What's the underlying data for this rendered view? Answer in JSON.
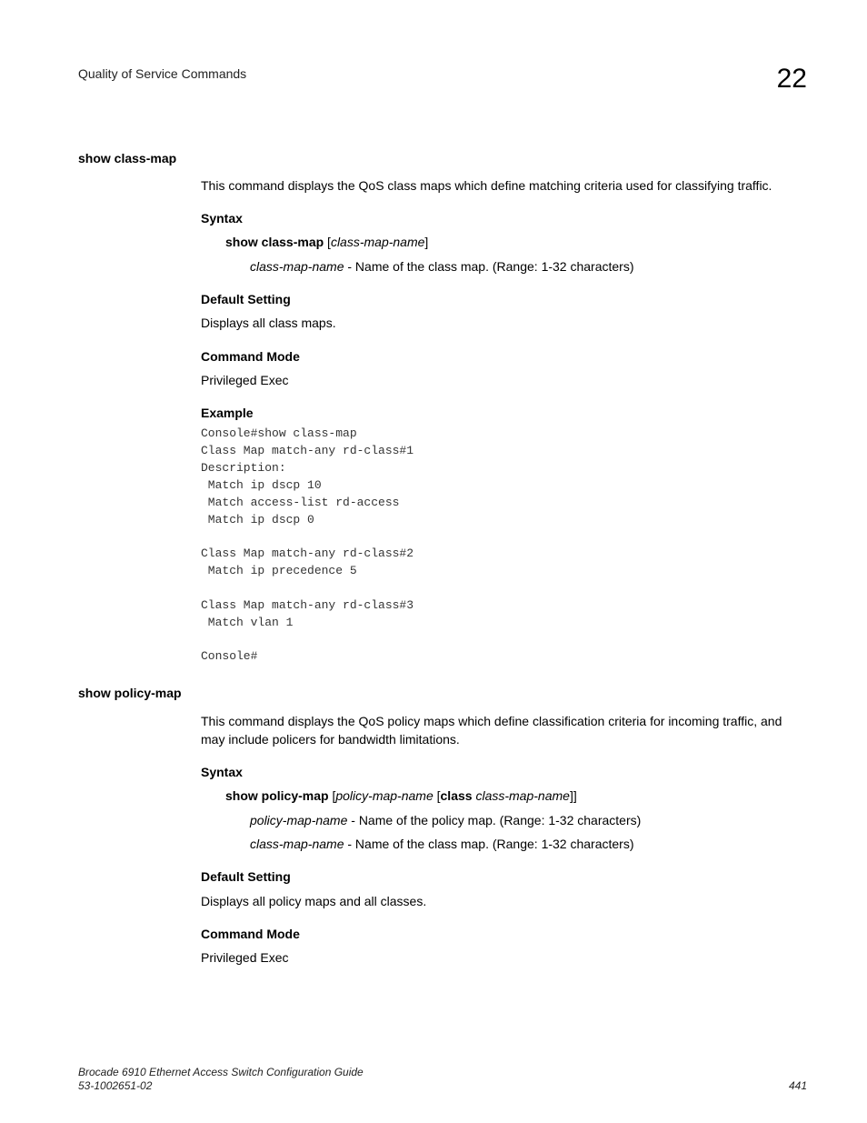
{
  "header": {
    "running_title": "Quality of Service Commands",
    "chapter_number": "22"
  },
  "sections": [
    {
      "left_heading": "show class-map",
      "intro": "This command displays the QoS class maps which define matching criteria used for classifying traffic.",
      "syntax_heading": "Syntax",
      "syntax_cmd_bold": "show class-map",
      "syntax_open_bracket": " [",
      "syntax_param_ital": "class-map-name",
      "syntax_close_bracket": "]",
      "params": [
        {
          "name": "class-map-name",
          "desc": " - Name of the class map. (Range: 1-32 characters)"
        }
      ],
      "default_heading": "Default Setting",
      "default_text": "Displays all class maps.",
      "mode_heading": "Command Mode",
      "mode_text": "Privileged Exec",
      "example_heading": "Example",
      "example_code": "Console#show class-map \nClass Map match-any rd-class#1\nDescription:\n Match ip dscp 10\n Match access-list rd-access\n Match ip dscp 0\n\nClass Map match-any rd-class#2\n Match ip precedence 5\n\nClass Map match-any rd-class#3\n Match vlan 1\n\nConsole#"
    },
    {
      "left_heading": "show policy-map",
      "intro": "This command displays the QoS policy maps which define classification criteria for incoming traffic, and may include policers for bandwidth limitations.",
      "syntax_heading": "Syntax",
      "syntax_cmd_bold1": "show policy-map",
      "syntax_open1": " [",
      "syntax_ital1": "policy-map-name",
      "syntax_open2": " [",
      "syntax_bold2": "class",
      "syntax_space": " ",
      "syntax_ital2": "class-map-name",
      "syntax_close": "]]",
      "params": [
        {
          "name": "policy-map-name",
          "desc": " - Name of the policy map. (Range: 1-32 characters)"
        },
        {
          "name": "class-map-name",
          "desc": " - Name of the class map. (Range: 1-32 characters)"
        }
      ],
      "default_heading": "Default Setting",
      "default_text": "Displays all policy maps and all classes.",
      "mode_heading": "Command Mode",
      "mode_text": "Privileged Exec"
    }
  ],
  "footer": {
    "guide_title": "Brocade 6910 Ethernet Access Switch Configuration Guide",
    "doc_number": "53-1002651-02",
    "page_number": "441"
  }
}
